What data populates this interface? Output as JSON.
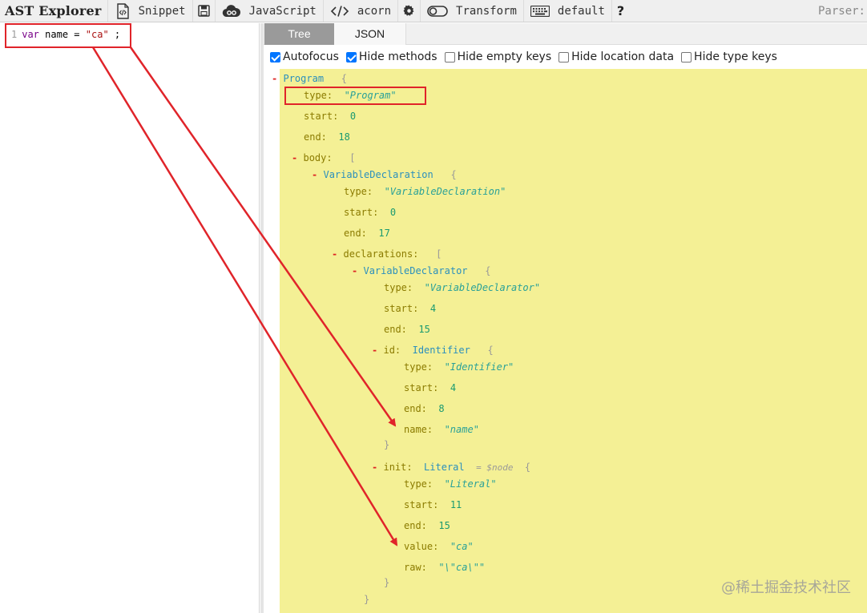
{
  "toolbar": {
    "brand": "AST Explorer",
    "snippet_label": "Snippet",
    "language_label": "JavaScript",
    "parser_label": "acorn",
    "transform_label": "Transform",
    "keymap_label": "default",
    "parser_status": "Parser:",
    "icons": [
      "snippet-icon",
      "save-icon",
      "gist-cloud-icon",
      "code-icon",
      "settings-gear-icon",
      "toggle-icon",
      "keyboard-icon",
      "help-icon"
    ]
  },
  "editor": {
    "line_number": "1",
    "code": {
      "keyword": "var",
      "identifier": "name",
      "operator": "=",
      "string": "\"ca\"",
      "terminator": ";"
    }
  },
  "output": {
    "tabs": [
      "Tree",
      "JSON"
    ],
    "active_tab": "Tree",
    "options": [
      {
        "label": "Autofocus",
        "checked": true
      },
      {
        "label": "Hide methods",
        "checked": true
      },
      {
        "label": "Hide empty keys",
        "checked": false
      },
      {
        "label": "Hide location data",
        "checked": false
      },
      {
        "label": "Hide type keys",
        "checked": false
      }
    ]
  },
  "tree": {
    "program": {
      "toggle": "-",
      "name": "Program",
      "open": "{",
      "type_key": "type:",
      "type_val": "\"Program\"",
      "start_key": "start:",
      "start_val": "0",
      "end_key": "end:",
      "end_val": "18"
    },
    "body": {
      "toggle": "-",
      "key": "body:",
      "open": "["
    },
    "var_decl": {
      "toggle": "-",
      "name": "VariableDeclaration",
      "open": "{",
      "type_key": "type:",
      "type_val": "\"VariableDeclaration\"",
      "start_key": "start:",
      "start_val": "0",
      "end_key": "end:",
      "end_val": "17"
    },
    "declarations": {
      "toggle": "-",
      "key": "declarations:",
      "open": "["
    },
    "declarator": {
      "toggle": "-",
      "name": "VariableDeclarator",
      "open": "{",
      "type_key": "type:",
      "type_val": "\"VariableDeclarator\"",
      "start_key": "start:",
      "start_val": "4",
      "end_key": "end:",
      "end_val": "15"
    },
    "id": {
      "toggle": "-",
      "key": "id:",
      "name": "Identifier",
      "open": "{",
      "type_key": "type:",
      "type_val": "\"Identifier\"",
      "start_key": "start:",
      "start_val": "4",
      "end_key": "end:",
      "end_val": "8",
      "name_key": "name:",
      "name_val": "\"name\"",
      "close": "}"
    },
    "init": {
      "toggle": "-",
      "key": "init:",
      "name": "Literal",
      "hint": "= $node",
      "open": "{",
      "type_key": "type:",
      "type_val": "\"Literal\"",
      "start_key": "start:",
      "start_val": "11",
      "end_key": "end:",
      "end_val": "15",
      "value_key": "value:",
      "value_val": "\"ca\"",
      "raw_key": "raw:",
      "raw_val": "\"\\\"ca\\\"\"",
      "close": "}"
    },
    "declarator_close": "}"
  },
  "watermark": "@稀土掘金技术社区",
  "colors": {
    "highlight": "#e0242a",
    "tree_background": "#f4f095",
    "toggle": "#d22222",
    "node_name": "#2a8fbd",
    "key": "#8b7b00",
    "string": "#2aa198",
    "number": "#1a9a70"
  }
}
